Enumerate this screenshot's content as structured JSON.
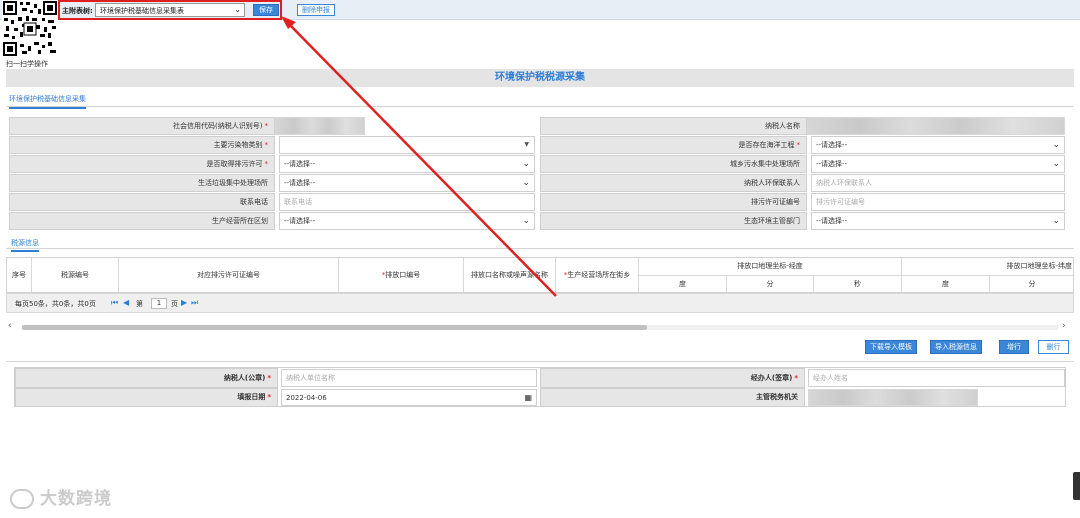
{
  "qr_caption": "扫一扫学操作",
  "header": {
    "report_label": "主附表树:",
    "report_value": "环境保护税基础信息采集表",
    "save_label": "保存",
    "delete_report_label": "删除申报"
  },
  "page_title": "环境保护税税源采集",
  "basic_tab": "环境保护税基础信息采集",
  "form": {
    "credit_code": "社会信用代码(纳税人识别号)",
    "taxpayer_name": "纳税人名称",
    "pollutant_type": "主要污染物类别",
    "marine_project": "是否存在海洋工程",
    "pollution_permit": "是否取得排污许可",
    "urban_sewage": "城乡污水集中处理场所",
    "garbage_site": "生活垃圾集中处理场所",
    "env_contact": "纳税人环保联系人",
    "phone": "联系电话",
    "permit_no": "排污许可证编号",
    "district": "生产经营所在区划",
    "eco_dept": "生态环境主管部门",
    "select_placeholder": "--请选择--",
    "env_contact_placeholder": "纳税人环保联系人",
    "phone_placeholder": "联系电话",
    "permit_no_placeholder": "排污许可证编号"
  },
  "source_tab": "税源信息",
  "grid": {
    "col_seq": "序号",
    "col_source_no": "税源编号",
    "col_permit_no": "对应排污许可证编号",
    "col_outlet_no": "排放口编号",
    "col_outlet_name": "排放口名称或噪声源名称",
    "col_street": "生产经营场所在街乡",
    "col_lon_group": "排放口地理坐标-经度",
    "col_lat_group": "排放口地理坐标-纬度",
    "deg": "度",
    "min": "分",
    "sec": "秒"
  },
  "pager": {
    "summary": "每页50条，共0条，共0页",
    "page_prefix": "第",
    "page_value": "1",
    "page_suffix": "页"
  },
  "actions": {
    "download_template": "下载导入模板",
    "import_sources": "导入税源信息",
    "add_row": "增行",
    "delete_row": "删行"
  },
  "sign": {
    "taxpayer_seal": "纳税人(公章)",
    "taxpayer_seal_placeholder": "纳税人单位名称",
    "agent": "经办人(签章)",
    "agent_placeholder": "经办人姓名",
    "fill_date": "填报日期",
    "fill_date_value": "2022-04-06",
    "tax_authority": "主管税务机关"
  },
  "watermark": "大数跨境",
  "colors": {
    "accent": "#2f7ed8",
    "highlight": "#e02020"
  }
}
